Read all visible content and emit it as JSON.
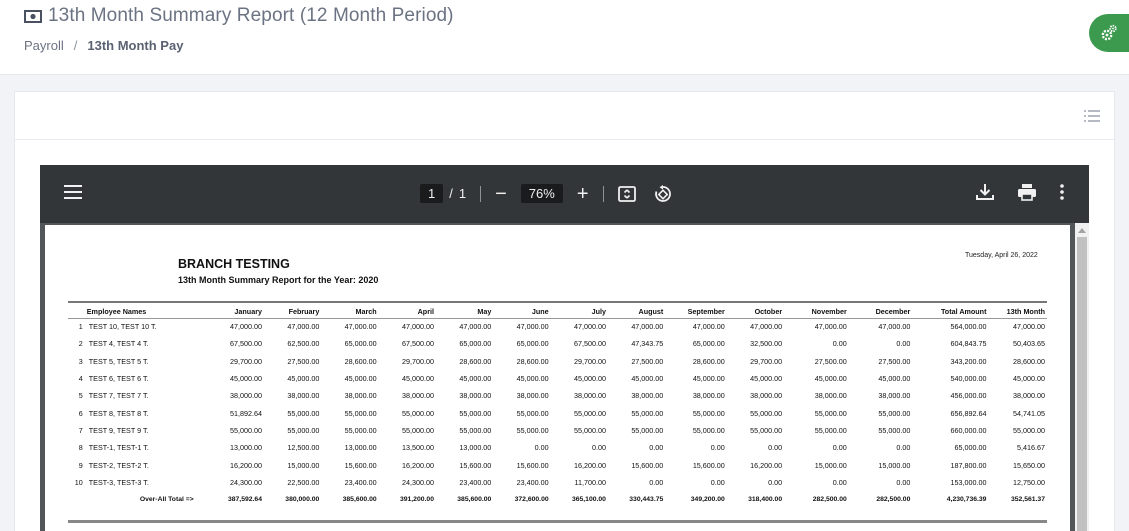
{
  "page": {
    "title": "13th Month Summary Report (12 Month Period)",
    "breadcrumb": [
      "Payroll",
      "13th Month Pay"
    ],
    "breadcrumb_sep": "/"
  },
  "viewer": {
    "page_current": "1",
    "page_sep": "/",
    "page_total": "1",
    "zoom": "76%",
    "zoom_out_label": "−",
    "zoom_in_label": "+"
  },
  "report": {
    "date": "Tuesday, April 26, 2022",
    "branch": "BRANCH TESTING",
    "subtitle": "13th Month Summary Report for the Year: 2020",
    "columns": [
      "Employee Names",
      "January",
      "February",
      "March",
      "April",
      "May",
      "June",
      "July",
      "August",
      "September",
      "October",
      "November",
      "December",
      "Total Amount",
      "13th Month"
    ],
    "rows": [
      {
        "idx": "1",
        "name": "TEST 10, TEST 10 T.",
        "values": [
          "47,000.00",
          "47,000.00",
          "47,000.00",
          "47,000.00",
          "47,000.00",
          "47,000.00",
          "47,000.00",
          "47,000.00",
          "47,000.00",
          "47,000.00",
          "47,000.00",
          "47,000.00",
          "564,000.00",
          "47,000.00"
        ]
      },
      {
        "idx": "2",
        "name": "TEST 4, TEST 4 T.",
        "values": [
          "67,500.00",
          "62,500.00",
          "65,000.00",
          "67,500.00",
          "65,000.00",
          "65,000.00",
          "67,500.00",
          "47,343.75",
          "65,000.00",
          "32,500.00",
          "0.00",
          "0.00",
          "604,843.75",
          "50,403.65"
        ]
      },
      {
        "idx": "3",
        "name": "TEST 5, TEST 5 T.",
        "values": [
          "29,700.00",
          "27,500.00",
          "28,600.00",
          "29,700.00",
          "28,600.00",
          "28,600.00",
          "29,700.00",
          "27,500.00",
          "28,600.00",
          "29,700.00",
          "27,500.00",
          "27,500.00",
          "343,200.00",
          "28,600.00"
        ]
      },
      {
        "idx": "4",
        "name": "TEST 6, TEST 6 T.",
        "values": [
          "45,000.00",
          "45,000.00",
          "45,000.00",
          "45,000.00",
          "45,000.00",
          "45,000.00",
          "45,000.00",
          "45,000.00",
          "45,000.00",
          "45,000.00",
          "45,000.00",
          "45,000.00",
          "540,000.00",
          "45,000.00"
        ]
      },
      {
        "idx": "5",
        "name": "TEST 7, TEST 7 T.",
        "values": [
          "38,000.00",
          "38,000.00",
          "38,000.00",
          "38,000.00",
          "38,000.00",
          "38,000.00",
          "38,000.00",
          "38,000.00",
          "38,000.00",
          "38,000.00",
          "38,000.00",
          "38,000.00",
          "456,000.00",
          "38,000.00"
        ]
      },
      {
        "idx": "6",
        "name": "TEST 8, TEST 8 T.",
        "values": [
          "51,892.64",
          "55,000.00",
          "55,000.00",
          "55,000.00",
          "55,000.00",
          "55,000.00",
          "55,000.00",
          "55,000.00",
          "55,000.00",
          "55,000.00",
          "55,000.00",
          "55,000.00",
          "656,892.64",
          "54,741.05"
        ]
      },
      {
        "idx": "7",
        "name": "TEST 9, TEST 9 T.",
        "values": [
          "55,000.00",
          "55,000.00",
          "55,000.00",
          "55,000.00",
          "55,000.00",
          "55,000.00",
          "55,000.00",
          "55,000.00",
          "55,000.00",
          "55,000.00",
          "55,000.00",
          "55,000.00",
          "660,000.00",
          "55,000.00"
        ]
      },
      {
        "idx": "8",
        "name": "TEST-1, TEST-1 T.",
        "values": [
          "13,000.00",
          "12,500.00",
          "13,000.00",
          "13,500.00",
          "13,000.00",
          "0.00",
          "0.00",
          "0.00",
          "0.00",
          "0.00",
          "0.00",
          "0.00",
          "65,000.00",
          "5,416.67"
        ]
      },
      {
        "idx": "9",
        "name": "TEST-2, TEST-2 T.",
        "values": [
          "16,200.00",
          "15,000.00",
          "15,600.00",
          "16,200.00",
          "15,600.00",
          "15,600.00",
          "16,200.00",
          "15,600.00",
          "15,600.00",
          "16,200.00",
          "15,000.00",
          "15,000.00",
          "187,800.00",
          "15,650.00"
        ]
      },
      {
        "idx": "10",
        "name": "TEST-3, TEST-3 T.",
        "values": [
          "24,300.00",
          "22,500.00",
          "23,400.00",
          "24,300.00",
          "23,400.00",
          "23,400.00",
          "11,700.00",
          "0.00",
          "0.00",
          "0.00",
          "0.00",
          "0.00",
          "153,000.00",
          "12,750.00"
        ]
      }
    ],
    "total_label": "Over-All Total =>",
    "totals": [
      "387,592.64",
      "380,000.00",
      "385,600.00",
      "391,200.00",
      "385,600.00",
      "372,600.00",
      "365,100.00",
      "330,443.75",
      "349,200.00",
      "318,400.00",
      "282,500.00",
      "282,500.00",
      "4,230,736.39",
      "352,561.37"
    ]
  },
  "icons": {
    "title_icon": "money-bill-icon",
    "fab_icon": "cogs-icon",
    "card_icon": "list-icon",
    "toolbar": [
      "menu-icon",
      "fit-page-icon",
      "rotate-icon",
      "download-icon",
      "print-icon",
      "more-vert-icon"
    ]
  },
  "colors": {
    "accent_green": "#3c9a4e",
    "viewer_toolbar": "#323639",
    "viewer_bg": "#525659"
  }
}
